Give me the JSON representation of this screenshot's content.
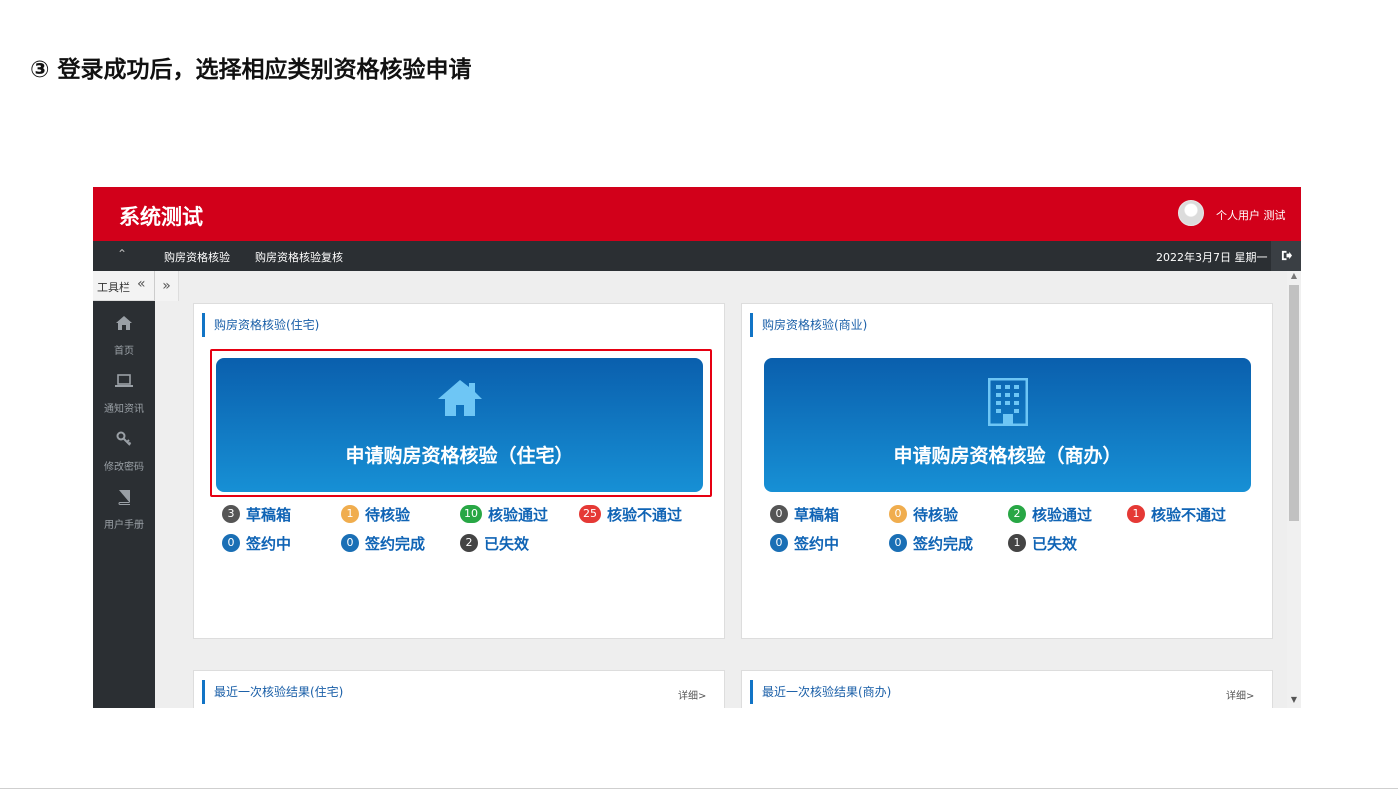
{
  "heading": "③ 登录成功后，选择相应类别资格核验申请",
  "colors": {
    "brand_red": "#d2001a",
    "nav_dark": "#2b2f33",
    "accent_blue": "#1174c6",
    "highlight_red": "#e60012"
  },
  "app": {
    "title": "系统测试",
    "user_label": "个人用户 测试",
    "nav": {
      "collapse_icon": "double-up-chevron",
      "items": [
        "购房资格核验",
        "购房资格核验复核"
      ],
      "date": "2022年3月7日 星期一",
      "logout_icon": "sign-out-icon"
    },
    "toolbar": {
      "label": "工具栏",
      "collapse_icon": "«",
      "expand_icon": "»"
    },
    "sidebar": [
      {
        "label": "首页",
        "icon": "home-icon"
      },
      {
        "label": "通知资讯",
        "icon": "laptop-icon"
      },
      {
        "label": "修改密码",
        "icon": "key-icon"
      },
      {
        "label": "用户手册",
        "icon": "book-icon"
      }
    ],
    "panels": {
      "residential": {
        "title": "购房资格核验(住宅)",
        "button_label": "申请购房资格核验（住宅）",
        "button_icon": "house-icon",
        "stats": [
          {
            "count": "3",
            "label": "草稿箱",
            "color": "#555555"
          },
          {
            "count": "1",
            "label": "待核验",
            "color": "#f0ad4e"
          },
          {
            "count": "10",
            "label": "核验通过",
            "color": "#28a745"
          },
          {
            "count": "25",
            "label": "核验不通过",
            "color": "#e53935"
          },
          {
            "count": "0",
            "label": "签约中",
            "color": "#1a6fb5"
          },
          {
            "count": "0",
            "label": "签约完成",
            "color": "#1a6fb5"
          },
          {
            "count": "2",
            "label": "已失效",
            "color": "#444444"
          }
        ]
      },
      "commercial": {
        "title": "购房资格核验(商业)",
        "button_label": "申请购房资格核验（商办）",
        "button_icon": "office-building-icon",
        "stats": [
          {
            "count": "0",
            "label": "草稿箱",
            "color": "#555555"
          },
          {
            "count": "0",
            "label": "待核验",
            "color": "#f0ad4e"
          },
          {
            "count": "2",
            "label": "核验通过",
            "color": "#28a745"
          },
          {
            "count": "1",
            "label": "核验不通过",
            "color": "#e53935"
          },
          {
            "count": "0",
            "label": "签约中",
            "color": "#1a6fb5"
          },
          {
            "count": "0",
            "label": "签约完成",
            "color": "#1a6fb5"
          },
          {
            "count": "1",
            "label": "已失效",
            "color": "#444444"
          }
        ]
      },
      "last_residential": {
        "title": "最近一次核验结果(住宅)",
        "detail": "详细>"
      },
      "last_commercial": {
        "title": "最近一次核验结果(商办)",
        "detail": "详细>"
      }
    }
  }
}
